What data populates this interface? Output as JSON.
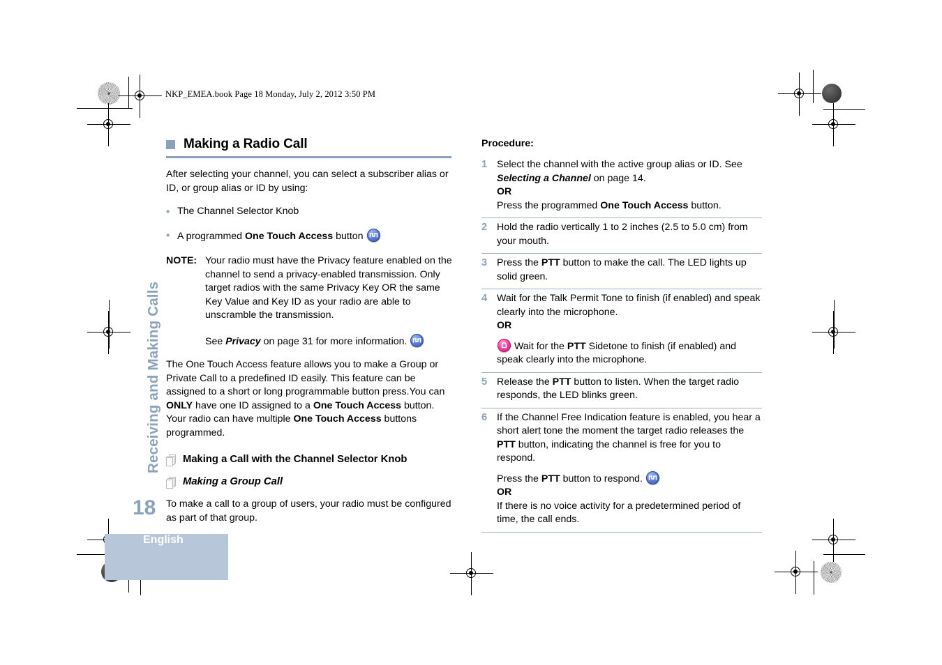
{
  "page": {
    "file_header": "NKP_EMEA.book  Page 18  Monday, July 2, 2012  3:50 PM",
    "side_tab": "Receiving and Making Calls",
    "page_number": "18",
    "language": "English",
    "accent_color": "#8ba2bd",
    "tab_bg_color": "#b7c6d8"
  },
  "left": {
    "section_title": "Making a Radio Call",
    "intro": "After selecting your channel, you can select a subscriber alias or ID, or group alias or ID by using:",
    "bullets": [
      {
        "text_before": "The Channel Selector Knob",
        "bold": "",
        "text_after": "",
        "icon": ""
      },
      {
        "text_before": "A programmed ",
        "bold": "One Touch Access",
        "text_after": " button ",
        "icon": "one-touch-access-button-icon"
      }
    ],
    "note": {
      "label": "NOTE:",
      "paragraph1": "Your radio must have the Privacy feature enabled on the channel to send a privacy-enabled transmission. Only target radios with the same Privacy Key OR the same Key Value and Key ID as your radio are able to unscramble the transmission.",
      "see_prefix": "See ",
      "see_italic": "Privacy",
      "see_suffix": " on page 31 for more information. "
    },
    "one_touch_paragraph": {
      "p1": "The One Touch Access feature allows you to make a Group or Private Call to a predefined ID easily. This feature can be assigned to a short or long programmable button press.You can ",
      "b1": "ONLY",
      "p2": " have one ID assigned to a ",
      "b2": "One Touch Access",
      "p3": " button. Your radio can have multiple ",
      "b3": "One Touch Access",
      "p4": " buttons programmed."
    },
    "subhead1": "Making a Call with the Channel Selector Knob",
    "subhead2": "Making a Group Call",
    "closing": "To make a call to a group of users, your radio must be configured as part of that group."
  },
  "right": {
    "procedure_label": "Procedure:",
    "steps": [
      {
        "num": "1",
        "l1_a": "Select the channel with the active group alias or ID. See ",
        "l1_i": "Selecting a Channel",
        "l1_b": " on page 14.",
        "or": "OR",
        "l2_a": "Press the programmed ",
        "l2_bold": "One Touch Access",
        "l2_b": " button."
      },
      {
        "num": "2",
        "text": "Hold the radio vertically 1 to 2 inches (2.5 to 5.0 cm) from your mouth."
      },
      {
        "num": "3",
        "a": "Press the ",
        "bold": "PTT",
        "b": " button to make the call. The LED lights up solid green."
      },
      {
        "num": "4",
        "a": "Wait for the Talk Permit Tone to finish (if enabled) and speak clearly into the microphone.",
        "or": "OR",
        "icon": "privacy-sidetone-icon",
        "b_a": " Wait for the ",
        "b_bold": "PTT",
        "b_b": " Sidetone to finish (if enabled) and speak clearly into the microphone."
      },
      {
        "num": "5",
        "a": "Release the ",
        "bold": "PTT",
        "b": " button to listen. When the target radio responds, the LED blinks green."
      },
      {
        "num": "6",
        "a": "If the Channel Free Indication feature is enabled, you hear a short alert tone the moment the target radio releases the ",
        "bold": "PTT",
        "b": " button, indicating the channel is free for you to respond.",
        "c_a": "Press the ",
        "c_bold": "PTT",
        "c_b": " button to respond. ",
        "icon": "one-touch-access-button-icon",
        "or": "OR",
        "d": "If there is no voice activity for a predetermined period of time, the call ends."
      }
    ]
  }
}
